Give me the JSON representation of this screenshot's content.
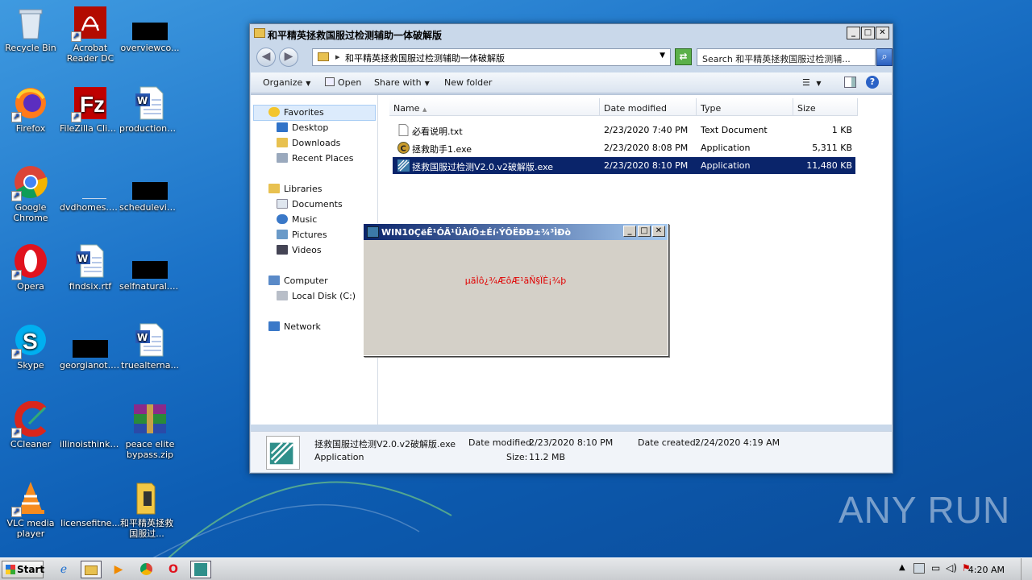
{
  "desktop": {
    "icons": [
      {
        "label": "Recycle Bin"
      },
      {
        "label": "Acrobat Reader DC"
      },
      {
        "label": "overviewco..."
      },
      {
        "label": "Firefox"
      },
      {
        "label": "FileZilla Client"
      },
      {
        "label": "productionp..."
      },
      {
        "label": "Google Chrome"
      },
      {
        "label": "dvdhomes.png"
      },
      {
        "label": "schedulevia..."
      },
      {
        "label": "Opera"
      },
      {
        "label": "findsix.rtf"
      },
      {
        "label": "selfnatural.jpg"
      },
      {
        "label": "Skype"
      },
      {
        "label": "georgianot.jpg"
      },
      {
        "label": "truealterna..."
      },
      {
        "label": "CCleaner"
      },
      {
        "label": "illinoisthink...."
      },
      {
        "label": "peace elite bypass.zip"
      },
      {
        "label": "VLC media player"
      },
      {
        "label": "licensefitne..."
      },
      {
        "label": "和平精英拯救国服过..."
      }
    ]
  },
  "explorer": {
    "title": "和平精英拯救国服过检测辅助一体破解版",
    "address": "和平精英拯救国服过检测辅助一体破解版",
    "search_placeholder": "Search 和平精英拯救国服过检测辅...",
    "toolbar": {
      "organize": "Organize",
      "open": "Open",
      "share": "Share with",
      "newfolder": "New folder"
    },
    "nav": {
      "favorites": "Favorites",
      "desktop": "Desktop",
      "downloads": "Downloads",
      "recent": "Recent Places",
      "libraries": "Libraries",
      "documents": "Documents",
      "music": "Music",
      "pictures": "Pictures",
      "videos": "Videos",
      "computer": "Computer",
      "localdisk": "Local Disk (C:)",
      "network": "Network"
    },
    "columns": {
      "name": "Name",
      "date": "Date modified",
      "type": "Type",
      "size": "Size"
    },
    "files": [
      {
        "name": "必看说明.txt",
        "date": "2/23/2020 7:40 PM",
        "type": "Text Document",
        "size": "1 KB"
      },
      {
        "name": "拯救助手1.exe",
        "date": "2/23/2020 8:08 PM",
        "type": "Application",
        "size": "5,311 KB"
      },
      {
        "name": "拯救国服过检测V2.0.v2破解版.exe",
        "date": "2/23/2020 8:10 PM",
        "type": "Application",
        "size": "11,480 KB"
      }
    ],
    "details": {
      "name": "拯救国服过检测V2.0.v2破解版.exe",
      "type": "Application",
      "modified_label": "Date modified:",
      "modified": "2/23/2020 8:10 PM",
      "created_label": "Date created:",
      "created": "2/24/2020 4:19 AM",
      "size_label": "Size:",
      "size": "11.2 MB"
    }
  },
  "dialog": {
    "title": "WIN10ÇëÊ¹ÓÃ¹ÜÀíÔ±Éí·ÝÔËÐÐ±¾³ÌÐò",
    "message": "µãÌô¿¾ÆôÆ¹ãÑ§ÏÈ¡¾þ"
  },
  "taskbar": {
    "start": "Start",
    "clock": "4:20 AM"
  },
  "watermark": "ANY RUN"
}
